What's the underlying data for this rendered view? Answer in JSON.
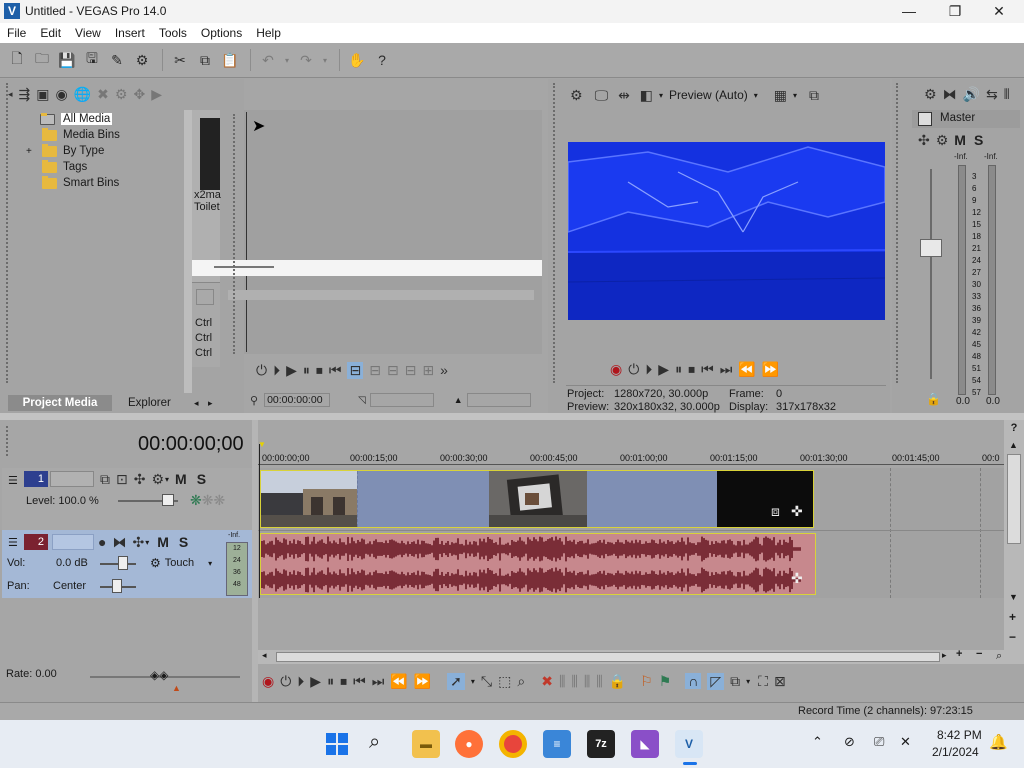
{
  "window": {
    "title": "Untitled - VEGAS Pro 14.0",
    "controls": {
      "minimize": "—",
      "maximize": "❐",
      "close": "✕"
    }
  },
  "menu": [
    "File",
    "Edit",
    "View",
    "Insert",
    "Tools",
    "Options",
    "Help"
  ],
  "project_media": {
    "tree": [
      "All Media",
      "Media Bins",
      "By Type",
      "Tags",
      "Smart Bins"
    ],
    "tree_expand": "+",
    "thumb_labels": [
      "x2ma",
      "Toilet"
    ],
    "ctrl_labels": [
      "Ctrl",
      "Ctrl",
      "Ctrl"
    ],
    "tabs": [
      "Project Media",
      "Explorer"
    ]
  },
  "trimmer": {
    "timecode": "00:00:00:00"
  },
  "preview": {
    "mode": "Preview (Auto)",
    "project_label": "Project:",
    "project_value": "1280x720, 30.000p",
    "preview_label": "Preview:",
    "preview_value": "320x180x32, 30.000p",
    "frame_label": "Frame:",
    "frame_value": "0",
    "display_label": "Display:",
    "display_value": "317x178x32"
  },
  "master": {
    "label": "Master",
    "m": "M",
    "s": "S",
    "inf_left": "-Inf.",
    "inf_right": "-Inf.",
    "scale": [
      "3",
      "6",
      "9",
      "12",
      "15",
      "18",
      "21",
      "24",
      "27",
      "30",
      "33",
      "36",
      "39",
      "42",
      "45",
      "48",
      "51",
      "54",
      "57"
    ],
    "readout_left": "0.0",
    "readout_right": "0.0"
  },
  "timeline": {
    "cursor_time": "00:00:00;00",
    "ruler": [
      "00:00:00;00",
      "00:00:15;00",
      "00:00:30;00",
      "00:00:45;00",
      "00:01:00;00",
      "00:01:15;00",
      "00:01:30;00",
      "00:01:45;00",
      "00:0"
    ],
    "rate": "Rate: 0.00"
  },
  "track1": {
    "number": "1",
    "m": "M",
    "s": "S",
    "level": "Level: 100.0 %"
  },
  "track2": {
    "number": "2",
    "m": "M",
    "s": "S",
    "vol_label": "Vol:",
    "vol_value": "0.0 dB",
    "pan_label": "Pan:",
    "pan_value": "Center",
    "automation": "Touch",
    "meter_top": "-Inf.",
    "meter_scale": [
      "12",
      "24",
      "36",
      "48"
    ]
  },
  "status": {
    "record_time": "Record Time (2 channels): 97:23:15"
  },
  "taskbar": {
    "time": "8:42 PM",
    "date": "2/1/2024",
    "apps": [
      "windows-start",
      "search",
      "file-explorer",
      "firefox",
      "chrome",
      "notepad",
      "7zip",
      "visual-studio",
      "vegas"
    ]
  },
  "colors": {
    "preview_blue": "#1029d6",
    "audio_event": "#c7888d",
    "audio_wave": "#7a2d37",
    "video_event": "#7f8fb4",
    "taskbar": "#e7ecf3"
  }
}
